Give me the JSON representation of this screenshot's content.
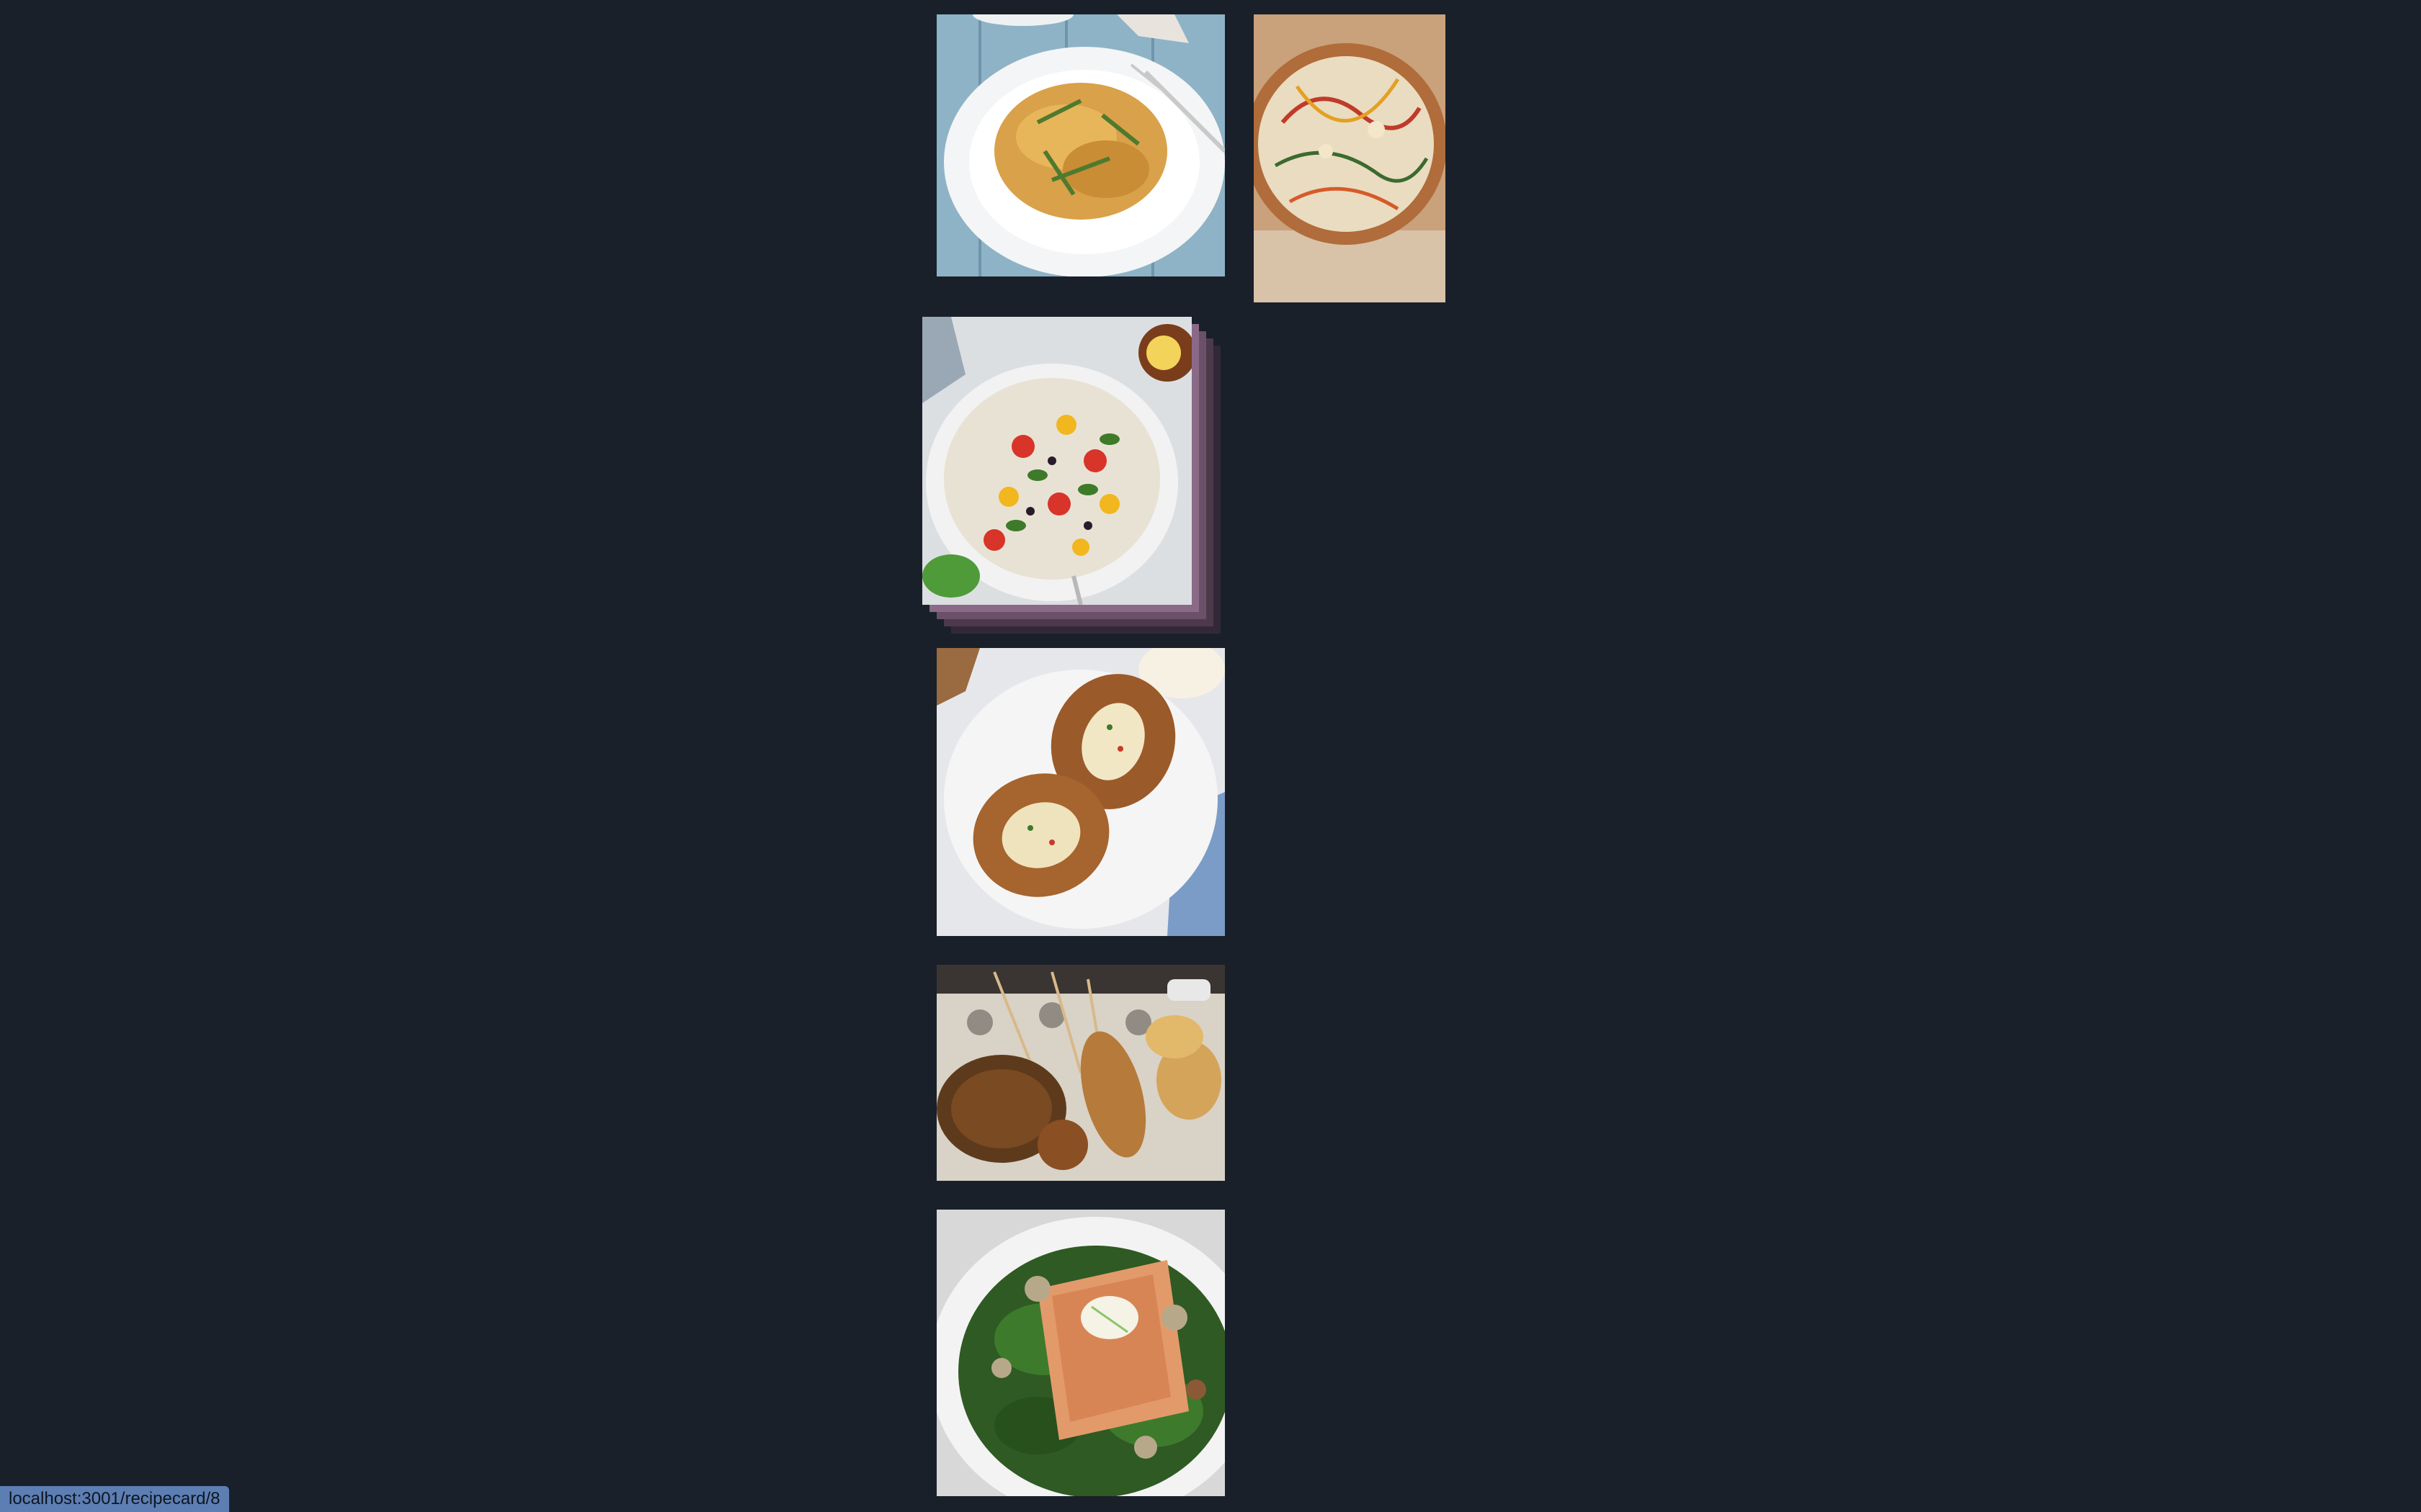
{
  "recipes": [
    {
      "id": "pasta",
      "icon": "pasta-dish-image"
    },
    {
      "id": "pizza",
      "icon": "pizza-image"
    },
    {
      "id": "salad",
      "icon": "pasta-salad-image",
      "hovered": true
    },
    {
      "id": "potato",
      "icon": "baked-potato-image"
    },
    {
      "id": "fried",
      "icon": "fried-skewers-image"
    },
    {
      "id": "salmon",
      "icon": "salmon-kale-image"
    }
  ],
  "status_bar": {
    "url": "localhost:3001/recipecard/8"
  },
  "colors": {
    "background": "#19202a",
    "status_bar": "#5d7eb3",
    "hover_stack": "#8a6a86"
  }
}
